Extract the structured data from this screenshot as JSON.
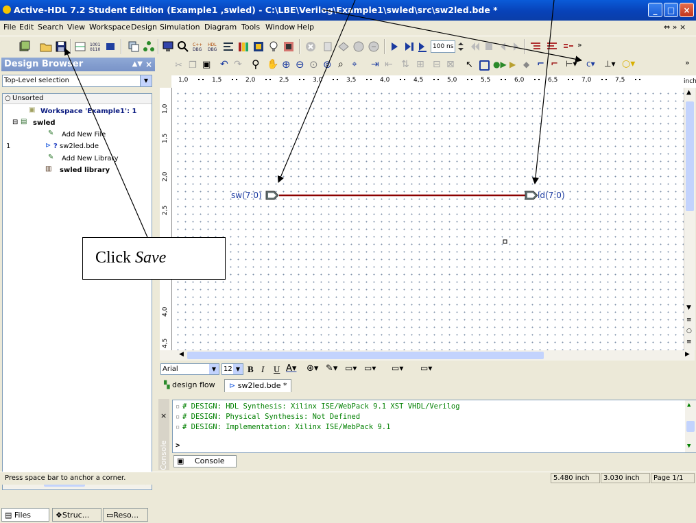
{
  "window": {
    "title": "Active-HDL 7.2 Student Edition (Example1 ,swled) - C:\\LBE\\Verilog\\Example1\\swled\\src\\sw2led.bde *",
    "controls": [
      "_",
      "□",
      "×"
    ]
  },
  "menu": [
    "File",
    "Edit",
    "Search",
    "View",
    "Workspace",
    "Design",
    "Simulation",
    "Diagram",
    "Tools",
    "Window",
    "Help"
  ],
  "menu_right": "⇔ » ×",
  "toolbar": {
    "sim_time": "100 ns",
    "chevron": "»"
  },
  "design_browser": {
    "title": "Design Browser",
    "selection": "Top-Level selection",
    "sorted": "Unsorted",
    "workspace": "Workspace 'Example1': 1",
    "design": "swled",
    "add_new_file": "Add New File",
    "file": "sw2led.bde",
    "file_index": "1",
    "file_status": "?",
    "add_new_library": "Add New Library",
    "library": "swled library",
    "tabs": [
      "Files",
      "Struc...",
      "Reso..."
    ]
  },
  "ruler": {
    "unit": "inch",
    "ticks": [
      "1,0",
      "1,5",
      "2,0",
      "2,5",
      "3,0",
      "3,5",
      "4,0",
      "4,5",
      "5,0",
      "5,5",
      "6,0",
      "6,5",
      "7,0",
      "7,5"
    ],
    "vticks": [
      "1,0",
      "1,5",
      "2,0",
      "2,5",
      "4,0",
      "4,5"
    ]
  },
  "diagram": {
    "input_port": "sw(7:0)",
    "output_port": "ld(7:0)",
    "wire_color": "#8b0000"
  },
  "format_bar": {
    "font": "Arial",
    "size": "12"
  },
  "doc_tabs": [
    "design flow",
    "sw2led.bde *"
  ],
  "console": {
    "lines": [
      "# DESIGN: HDL Synthesis: Xilinx ISE/WebPack 9.1 XST VHDL/Verilog",
      "# DESIGN: Physical Synthesis: Not Defined",
      "# DESIGN: Implementation: Xilinx ISE/WebPack 9.1"
    ],
    "prompt": ">",
    "tab": "Console",
    "side_label": "Console"
  },
  "status": {
    "message": "Press space bar to anchor a corner.",
    "x": "5.480 inch",
    "y": "3.030 inch",
    "page": "Page 1/1"
  },
  "annotation": {
    "prefix": "Click ",
    "action": "Save"
  }
}
